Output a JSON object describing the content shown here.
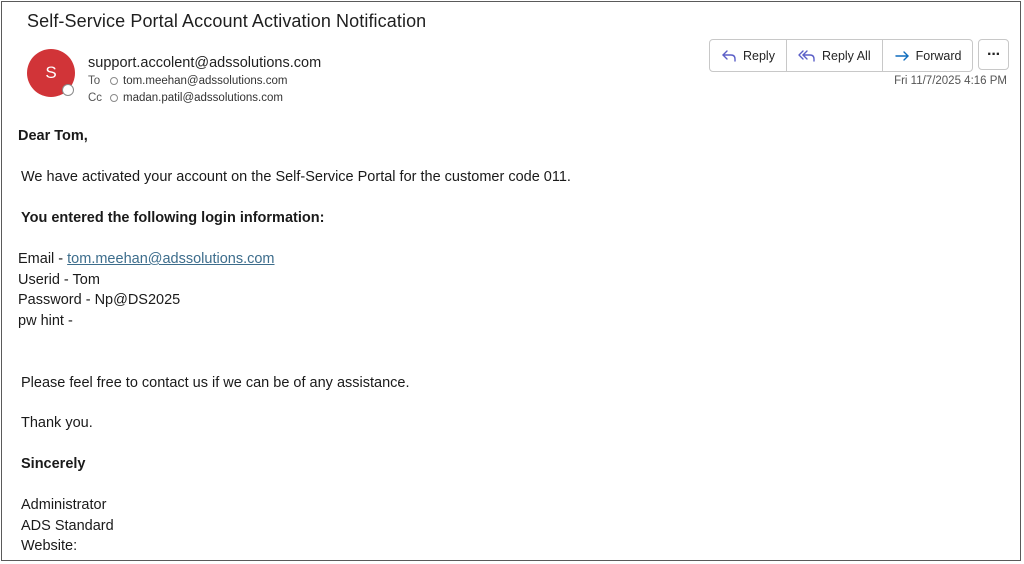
{
  "email": {
    "subject": "Self-Service Portal Account Activation Notification",
    "sender": {
      "initial": "S",
      "address": "support.accolent@adssolutions.com",
      "avatar_color": "#d13438"
    },
    "to": {
      "label": "To",
      "address": "tom.meehan@adssolutions.com"
    },
    "cc": {
      "label": "Cc",
      "address": "madan.patil@adssolutions.com"
    },
    "timestamp": "Fri 11/7/2025 4:16 PM",
    "actions": {
      "reply": "Reply",
      "reply_all": "Reply All",
      "forward": "Forward",
      "more": "···"
    },
    "body": {
      "greeting": "Dear Tom,",
      "intro": "We have activated your account on the Self-Service Portal for the customer code 011.",
      "login_heading": "You entered the following login information:",
      "email_label": "Email - ",
      "email_value": "tom.meehan@adssolutions.com",
      "userid_label": "Userid - ",
      "userid_value": "Tom",
      "password_label": "Password - ",
      "password_value": "Np@DS2025",
      "pwhint_label": "pw hint -",
      "contact": "Please feel free to contact us if we can be of any assistance.",
      "thanks": "Thank you.",
      "sincerely": "Sincerely",
      "signature_name": "Administrator",
      "signature_org": "ADS Standard",
      "website_label": "Website:"
    }
  }
}
